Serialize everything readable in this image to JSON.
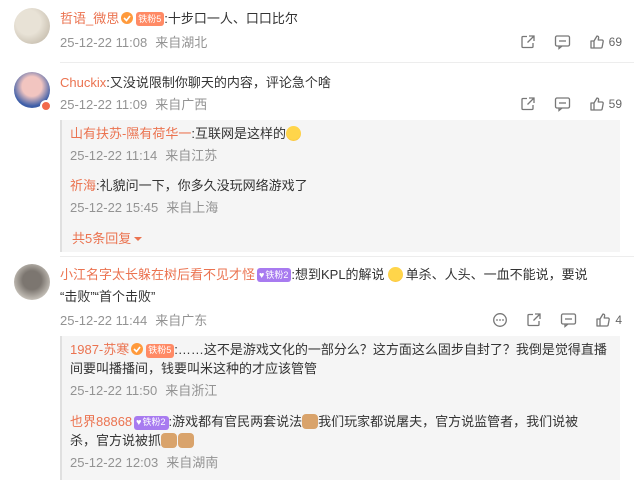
{
  "comments": [
    {
      "username": "哲语_微思",
      "badge": "铁粉5",
      "text": ":十步口一人、口口比尔",
      "date": "25-12-22 11:08",
      "location": "来自湖北",
      "likes": "69"
    },
    {
      "username": "Chuckix",
      "text": ":又没说限制你聊天的内容，评论急个啥",
      "date": "25-12-22 11:09",
      "location": "来自广西",
      "likes": "59",
      "replies": [
        {
          "username": "山有扶苏-隰有荷华一",
          "text": ":互联网是这样的",
          "date": "25-12-22 11:14",
          "location": "来自江苏"
        },
        {
          "username": "祈海",
          "text": ":礼貌问一下，你多久没玩网络游戏了",
          "date": "25-12-22 15:45",
          "location": "来自上海"
        }
      ],
      "more_replies": "共5条回复"
    },
    {
      "username": "小江名字太长躲在树后看不见才怪",
      "badge": "铁粉2",
      "text_line1": ":想到KPL的解说",
      "text_line1b": "单杀、人头、一血不能说，要说",
      "text_line2": "“击败”“首个击败”",
      "date": "25-12-22 11:44",
      "location": "来自广东",
      "likes": "4",
      "replies": [
        {
          "username": "1987-苏寒",
          "badge": "铁粉5",
          "text_line1": ":……这不是游戏文化的一部分么？这方面这么固步自封了？我倒是觉得直播",
          "text_line2": "间要叫播播间，钱要叫米这种的才应该管管",
          "date": "25-12-22 11:50",
          "location": "来自浙江"
        },
        {
          "username": "也界88868",
          "badge": "铁粉2",
          "text_line1a": ":游戏都有官民两套说法",
          "text_line1b": "我们玩家都说屠夫，官方说监管者，我们说被",
          "text_line2": "杀，官方说被抓",
          "date": "25-12-22 12:03",
          "location": "来自湖南"
        }
      ]
    }
  ],
  "icons": [
    "share-icon",
    "comment-icon",
    "like-icon",
    "more-icon"
  ],
  "colors": {
    "username": "#eb7350",
    "meta": "#939393",
    "text": "#333333"
  }
}
